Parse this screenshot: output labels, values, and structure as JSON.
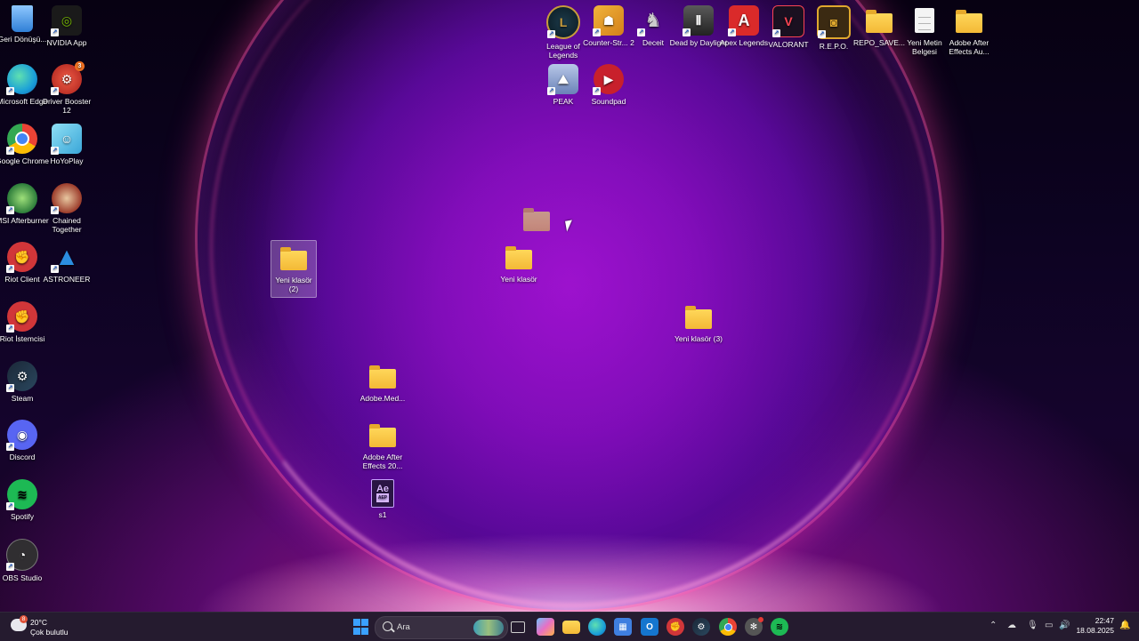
{
  "desktop": {
    "icons": [
      {
        "label": "Geri Dönüşü...",
        "icon": "recycle-bin-icon",
        "color": "#4aa3ff"
      },
      {
        "label": "NVIDIA App",
        "icon": "nvidia-icon",
        "color": "#76b900"
      },
      {
        "label": "Microsoft Edge",
        "icon": "edge-icon",
        "color": "#1ba0d8"
      },
      {
        "label": "Driver Booster 12",
        "icon": "driver-booster-icon",
        "color": "#d83a2a",
        "badge": "3"
      },
      {
        "label": "Google Chrome",
        "icon": "chrome-icon",
        "color": "#34a853"
      },
      {
        "label": "HoYoPlay",
        "icon": "hoyoplay-icon",
        "color": "#5bc6e8"
      },
      {
        "label": "MSI Afterburner",
        "icon": "msi-afterburner-icon",
        "color": "#2c7c3a"
      },
      {
        "label": "Chained Together",
        "icon": "chained-together-icon",
        "color": "#9b3b2a"
      },
      {
        "label": "Riot Client",
        "icon": "riot-client-icon",
        "color": "#d13639"
      },
      {
        "label": "ASTRONEER",
        "icon": "astroneer-icon",
        "color": "#2b8de0"
      },
      {
        "label": "Riot İstemcisi",
        "icon": "riot-client-icon",
        "color": "#d13639"
      },
      {
        "label": "Steam",
        "icon": "steam-icon",
        "color": "#1b2838"
      },
      {
        "label": "Discord",
        "icon": "discord-icon",
        "color": "#5865f2"
      },
      {
        "label": "Spotify",
        "icon": "spotify-icon",
        "color": "#1db954"
      },
      {
        "label": "OBS Studio",
        "icon": "obs-icon",
        "color": "#302e31"
      },
      {
        "label": "League of Legends",
        "icon": "league-of-legends-icon",
        "color": "#c89b3c"
      },
      {
        "label": "Counter-Str... 2",
        "icon": "counter-strike-icon",
        "color": "#e5a41f"
      },
      {
        "label": "Deceit",
        "icon": "deceit-icon",
        "color": "#6c6c6c"
      },
      {
        "label": "Dead by Daylight",
        "icon": "dead-by-daylight-icon",
        "color": "#3a3a3a"
      },
      {
        "label": "Apex Legends",
        "icon": "apex-legends-icon",
        "color": "#da2a2a"
      },
      {
        "label": "VALORANT",
        "icon": "valorant-icon",
        "color": "#fa4454"
      },
      {
        "label": "R.E.P.O.",
        "icon": "repo-icon",
        "color": "#e0a82e"
      },
      {
        "label": "REPO_SAVE...",
        "icon": "folder-icon",
        "color": "#f3b936"
      },
      {
        "label": "Yeni Metin Belgesi",
        "icon": "text-document-icon",
        "color": "#f4f4f4"
      },
      {
        "label": "Adobe After Effects Au...",
        "icon": "folder-icon",
        "color": "#f3b936"
      },
      {
        "label": "PEAK",
        "icon": "peak-icon",
        "color": "#9fb3d8"
      },
      {
        "label": "Soundpad",
        "icon": "soundpad-icon",
        "color": "#c8202c"
      },
      {
        "label": "Yeni klasör (2)",
        "icon": "folder-icon",
        "color": "#f3b936",
        "selected": true
      },
      {
        "label": "Yeni klasör",
        "icon": "folder-icon",
        "color": "#f3b936"
      },
      {
        "label": "Yeni klasör (3)",
        "icon": "folder-icon",
        "color": "#f3b936"
      },
      {
        "label": "Adobe.Med...",
        "icon": "folder-icon",
        "color": "#f3b936"
      },
      {
        "label": "Adobe After Effects 20...",
        "icon": "folder-icon",
        "color": "#f3b936"
      },
      {
        "label": "s1",
        "icon": "aep-file-icon",
        "color": "#2a1545",
        "filetag": "Ae",
        "subtag": "AEP"
      }
    ]
  },
  "taskbar": {
    "weather": {
      "temp": "20°C",
      "desc": "Çok bulutlu",
      "badge": "8"
    },
    "search_placeholder": "Ara",
    "time": "22:47",
    "date": "18.08.2025",
    "pinned": [
      {
        "icon": "start-icon",
        "color": "#3aa0ff"
      },
      {
        "icon": "task-view-icon",
        "color": "#cfcfcf"
      },
      {
        "icon": "copilot-icon",
        "color": "#e86fc4"
      },
      {
        "icon": "file-explorer-icon",
        "color": "#f3b936"
      },
      {
        "icon": "edge-icon",
        "color": "#1ba0d8"
      },
      {
        "icon": "microsoft-store-icon",
        "color": "#3f7fe0"
      },
      {
        "icon": "outlook-icon",
        "color": "#1576cf"
      },
      {
        "icon": "riot-client-icon",
        "color": "#d13639"
      },
      {
        "icon": "steam-icon",
        "color": "#1b2838"
      },
      {
        "icon": "chrome-icon",
        "color": "#34a853"
      },
      {
        "icon": "chatgpt-icon",
        "color": "#555555"
      },
      {
        "icon": "spotify-icon",
        "color": "#1db954"
      }
    ],
    "tray": [
      {
        "icon": "chevron-up-icon"
      },
      {
        "icon": "onedrive-icon"
      },
      {
        "icon": "microphone-icon"
      },
      {
        "icon": "network-icon"
      },
      {
        "icon": "speaker-icon"
      },
      {
        "icon": "notification-icon"
      }
    ]
  }
}
